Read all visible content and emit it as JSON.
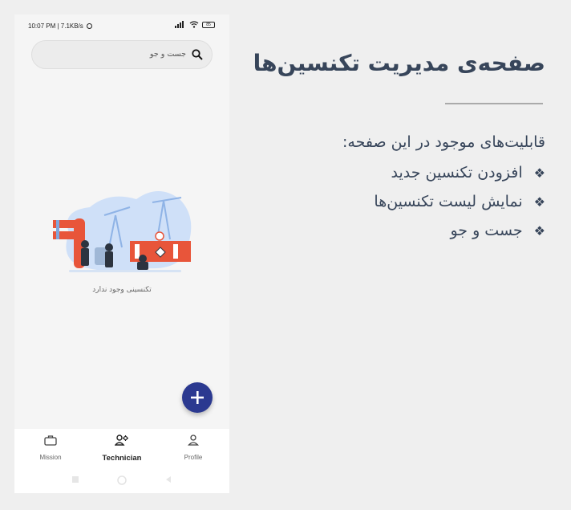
{
  "status_bar": {
    "time_speed": "10:07 PM | 7.1KB/s",
    "battery": "85"
  },
  "search": {
    "placeholder": "جست و جو"
  },
  "empty_state": {
    "message": "تکنسینی وجود ندارد"
  },
  "bottom_nav": {
    "items": [
      {
        "label": "Mission",
        "icon": "briefcase-icon"
      },
      {
        "label": "Technician",
        "icon": "technician-icon",
        "active": true
      },
      {
        "label": "Profile",
        "icon": "person-icon"
      }
    ]
  },
  "slide": {
    "title": "صفحه‌ی مدیریت تکنسین‌ها",
    "features_heading": "قابلیت‌های موجود در این صفحه:",
    "features": [
      "افزودن تکنسین جدید",
      "نمایش لیست تکنسین‌ها",
      "جست و جو"
    ]
  },
  "colors": {
    "accent": "#2b3990",
    "title_text": "#37455a",
    "pipe_red": "#e8553a",
    "blob_blue": "#cfe0f8"
  }
}
